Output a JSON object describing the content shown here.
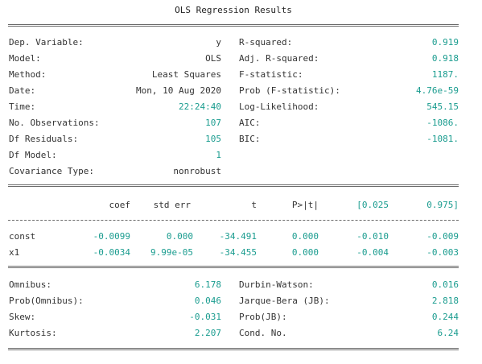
{
  "title": "OLS Regression Results",
  "top_left": [
    {
      "label": "Dep. Variable:",
      "value": "y"
    },
    {
      "label": "Model:",
      "value": "OLS"
    },
    {
      "label": "Method:",
      "value": "Least Squares"
    },
    {
      "label": "Date:",
      "value": "Mon, 10 Aug 2020"
    },
    {
      "label": "Time:",
      "value": "22:24:40"
    },
    {
      "label": "No. Observations:",
      "value": "107"
    },
    {
      "label": "Df Residuals:",
      "value": "105"
    },
    {
      "label": "Df Model:",
      "value": "1"
    },
    {
      "label": "Covariance Type:",
      "value": "nonrobust"
    }
  ],
  "top_right": [
    {
      "label": "R-squared:",
      "value": "0.919"
    },
    {
      "label": "Adj. R-squared:",
      "value": "0.918"
    },
    {
      "label": "F-statistic:",
      "value": "1187."
    },
    {
      "label": "Prob (F-statistic):",
      "value": "4.76e-59"
    },
    {
      "label": "Log-Likelihood:",
      "value": "545.15"
    },
    {
      "label": "AIC:",
      "value": "-1086."
    },
    {
      "label": "BIC:",
      "value": "-1081."
    }
  ],
  "coef_headers": [
    "coef",
    "std err",
    "t",
    "P>|t|",
    "[0.025",
    "0.975]"
  ],
  "coef_rows": [
    {
      "name": "const",
      "values": [
        "-0.0099",
        "0.000",
        "-34.491",
        "0.000",
        "-0.010",
        "-0.009"
      ]
    },
    {
      "name": "x1",
      "values": [
        "-0.0034",
        "9.99e-05",
        "-34.455",
        "0.000",
        "-0.004",
        "-0.003"
      ]
    }
  ],
  "bottom_left": [
    {
      "label": "Omnibus:",
      "value": "6.178"
    },
    {
      "label": "Prob(Omnibus):",
      "value": "0.046"
    },
    {
      "label": "Skew:",
      "value": "-0.031"
    },
    {
      "label": "Kurtosis:",
      "value": "2.207"
    }
  ],
  "bottom_right": [
    {
      "label": "Durbin-Watson:",
      "value": "0.016"
    },
    {
      "label": "Jarque-Bera (JB):",
      "value": "2.818"
    },
    {
      "label": "Prob(JB):",
      "value": "0.244"
    },
    {
      "label": "Cond. No.",
      "value": "6.24"
    }
  ],
  "colors": {
    "number": "#1a9c8f",
    "text": "#333333",
    "rule": "#6b6b6b"
  }
}
